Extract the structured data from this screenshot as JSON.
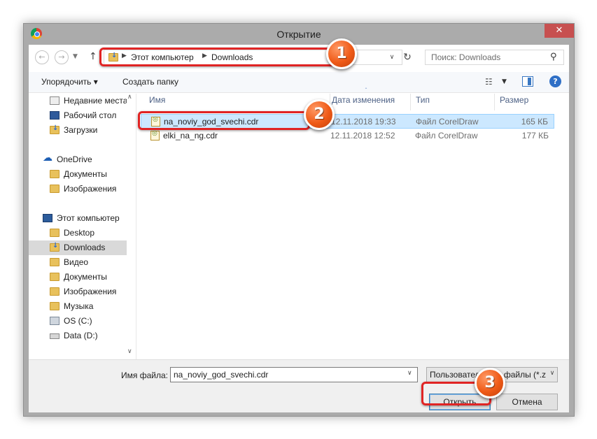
{
  "window": {
    "title": "Открытие",
    "close_label": "✕"
  },
  "address": {
    "crumbs": [
      "Этот компьютер",
      "Downloads"
    ]
  },
  "search": {
    "placeholder": "Поиск: Downloads"
  },
  "toolbar": {
    "organize_label": "Упорядочить ▾",
    "new_folder_label": "Создать папку"
  },
  "navpane": {
    "items": [
      {
        "label": "Недавние места",
        "icon": "recent-icon"
      },
      {
        "label": "Рабочий стол",
        "icon": "desktop-icon"
      },
      {
        "label": "Загрузки",
        "icon": "downloads-folder-icon"
      },
      {
        "label": "OneDrive",
        "icon": "cloud-icon"
      },
      {
        "label": "Документы",
        "icon": "folder-icon"
      },
      {
        "label": "Изображения",
        "icon": "folder-icon"
      },
      {
        "label": "Этот компьютер",
        "icon": "computer-icon"
      },
      {
        "label": "Desktop",
        "icon": "folder-icon"
      },
      {
        "label": "Downloads",
        "icon": "downloads-folder-icon",
        "selected": true
      },
      {
        "label": "Видео",
        "icon": "video-folder-icon"
      },
      {
        "label": "Документы",
        "icon": "documents-folder-icon"
      },
      {
        "label": "Изображения",
        "icon": "pictures-folder-icon"
      },
      {
        "label": "Музыка",
        "icon": "music-folder-icon"
      },
      {
        "label": "OS (C:)",
        "icon": "drive-c-icon"
      },
      {
        "label": "Data (D:)",
        "icon": "drive-icon"
      }
    ]
  },
  "columns": {
    "name": "Имя",
    "date": "Дата изменения",
    "type": "Тип",
    "size": "Размер"
  },
  "files": [
    {
      "name": "na_noviy_god_svechi.cdr",
      "date": "12.11.2018 19:33",
      "type": "Файл CorelDraw",
      "size": "165 КБ",
      "selected": true
    },
    {
      "name": "elki_na_ng.cdr",
      "date": "12.11.2018 12:52",
      "type": "Файл CorelDraw",
      "size": "177 КБ"
    }
  ],
  "bottom": {
    "filename_label": "Имя файла:",
    "filename_value": "na_noviy_god_svechi.cdr",
    "filetype_value": "Пользовательские файлы (*.z",
    "open_label": "Открыть",
    "cancel_label": "Отмена"
  },
  "annotations": {
    "badge1": "1",
    "badge2": "2",
    "badge3": "3",
    "highlight_color": "#e02424",
    "badge_color": "#ef5a17"
  }
}
